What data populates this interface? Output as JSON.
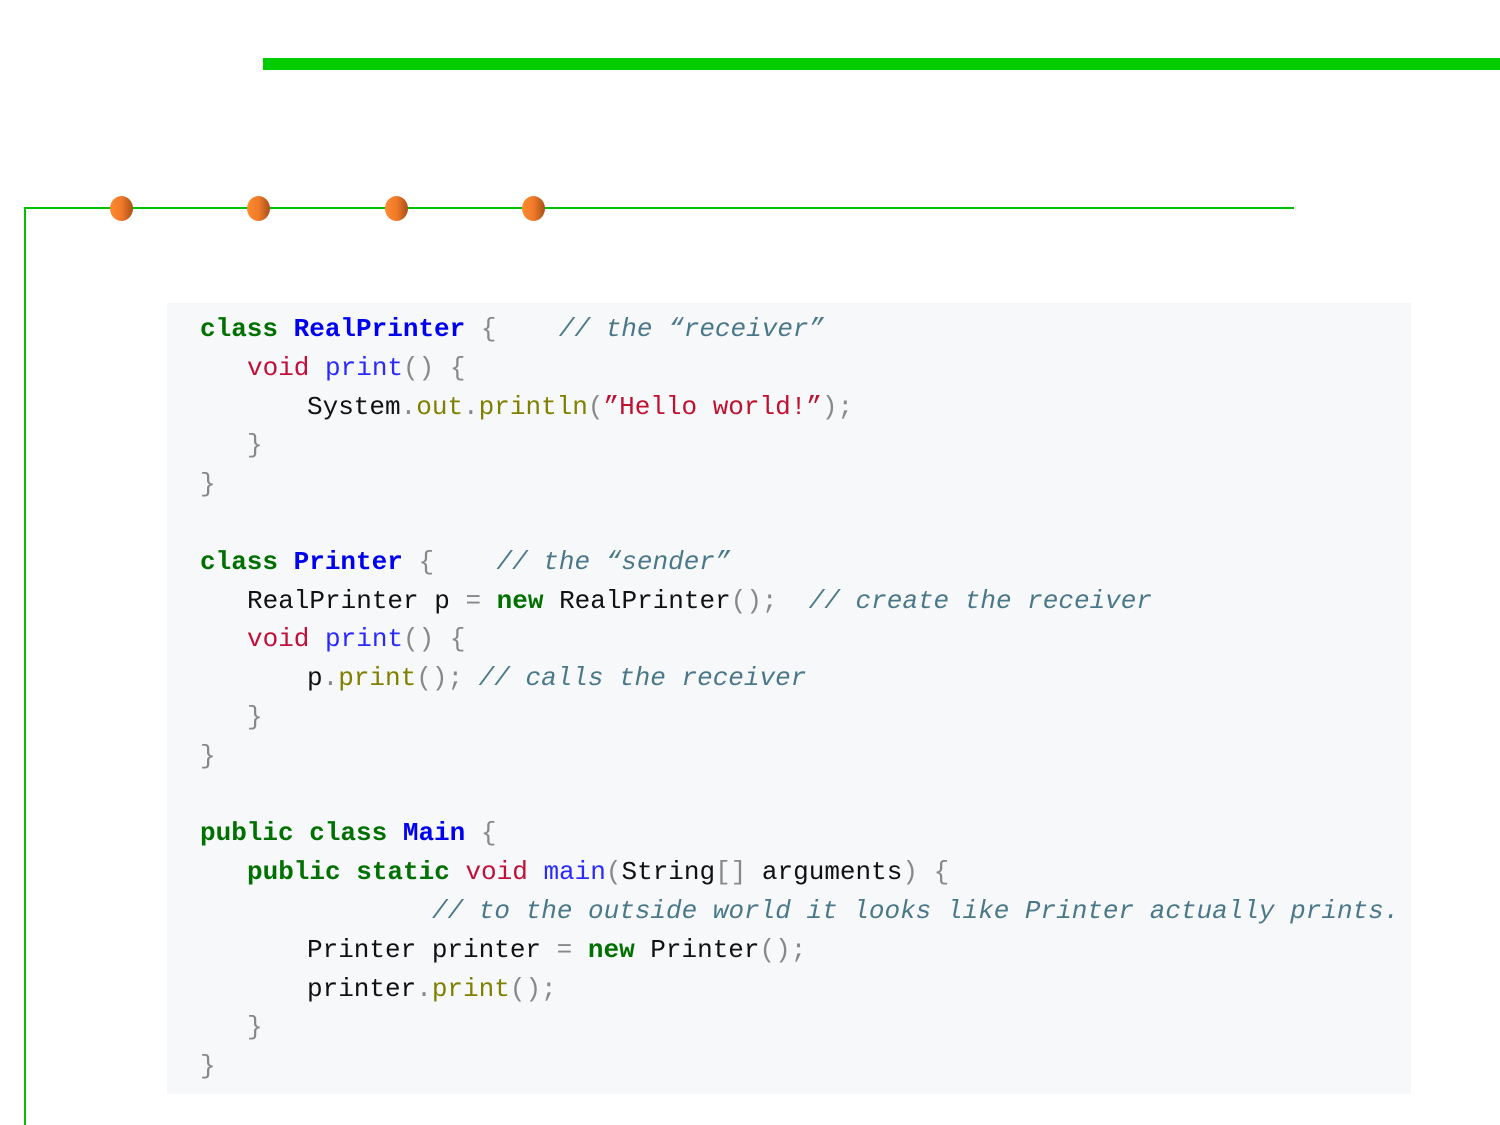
{
  "colors": {
    "accent_green": "#00cc00",
    "dot_orange": "#f07a28",
    "code_bg": "#f7f8fa"
  },
  "code_lines": [
    {
      "indent": 0,
      "tokens": [
        [
          "class ",
          "kw"
        ],
        [
          "RealPrinter",
          "cls"
        ],
        [
          " {    ",
          "pun"
        ],
        [
          "// the “receiver”",
          "cm"
        ]
      ]
    },
    {
      "indent": 1,
      "tokens": [
        [
          "void ",
          "typ"
        ],
        [
          "print",
          "fn"
        ],
        [
          "() {",
          "pun"
        ]
      ]
    },
    {
      "indent": 2,
      "tokens": [
        [
          "System",
          "id"
        ],
        [
          ".",
          "pun"
        ],
        [
          "out",
          "mem"
        ],
        [
          ".",
          "pun"
        ],
        [
          "println",
          "mem"
        ],
        [
          "(",
          "pun"
        ],
        [
          "”Hello world!”",
          "str"
        ],
        [
          ");",
          "pun"
        ]
      ]
    },
    {
      "indent": 1,
      "tokens": [
        [
          "}",
          "pun"
        ]
      ]
    },
    {
      "indent": 0,
      "tokens": [
        [
          "}",
          "pun"
        ]
      ]
    },
    {
      "indent": 0,
      "tokens": []
    },
    {
      "indent": 0,
      "tokens": [
        [
          "class ",
          "kw"
        ],
        [
          "Printer",
          "cls"
        ],
        [
          " {    ",
          "pun"
        ],
        [
          "// the “sender”",
          "cm"
        ]
      ]
    },
    {
      "indent": 1,
      "tokens": [
        [
          "RealPrinter p ",
          "id"
        ],
        [
          "= ",
          "pun"
        ],
        [
          "new ",
          "kw"
        ],
        [
          "RealPrinter",
          "id"
        ],
        [
          "();  ",
          "pun"
        ],
        [
          "// create the receiver",
          "cm"
        ]
      ]
    },
    {
      "indent": 1,
      "tokens": [
        [
          "void ",
          "typ"
        ],
        [
          "print",
          "fn"
        ],
        [
          "() {",
          "pun"
        ]
      ]
    },
    {
      "indent": 2,
      "tokens": [
        [
          "p",
          "id"
        ],
        [
          ".",
          "pun"
        ],
        [
          "print",
          "mem"
        ],
        [
          "(); ",
          "pun"
        ],
        [
          "// calls the receiver",
          "cm"
        ]
      ]
    },
    {
      "indent": 1,
      "tokens": [
        [
          "}",
          "pun"
        ]
      ]
    },
    {
      "indent": 0,
      "tokens": [
        [
          "}",
          "pun"
        ]
      ]
    },
    {
      "indent": 0,
      "tokens": []
    },
    {
      "indent": 0,
      "tokens": [
        [
          "public class ",
          "kw"
        ],
        [
          "Main",
          "cls"
        ],
        [
          " {",
          "pun"
        ]
      ]
    },
    {
      "indent": 1,
      "tokens": [
        [
          "public static ",
          "kw"
        ],
        [
          "void ",
          "typ"
        ],
        [
          "main",
          "fn"
        ],
        [
          "(",
          "pun"
        ],
        [
          "String",
          "id"
        ],
        [
          "[] ",
          "pun"
        ],
        [
          "arguments",
          "id"
        ],
        [
          ") {",
          "pun"
        ]
      ]
    },
    {
      "indent": 3,
      "tokens": [
        [
          "// to the outside world it looks like Printer actually prints.",
          "cm"
        ]
      ]
    },
    {
      "indent": 2,
      "tokens": [
        [
          "Printer printer ",
          "id"
        ],
        [
          "= ",
          "pun"
        ],
        [
          "new ",
          "kw"
        ],
        [
          "Printer",
          "id"
        ],
        [
          "();",
          "pun"
        ]
      ]
    },
    {
      "indent": 2,
      "tokens": [
        [
          "printer",
          "id"
        ],
        [
          ".",
          "pun"
        ],
        [
          "print",
          "mem"
        ],
        [
          "();",
          "pun"
        ]
      ]
    },
    {
      "indent": 1,
      "tokens": [
        [
          "}",
          "pun"
        ]
      ]
    },
    {
      "indent": 0,
      "tokens": [
        [
          "}",
          "pun"
        ]
      ]
    }
  ]
}
